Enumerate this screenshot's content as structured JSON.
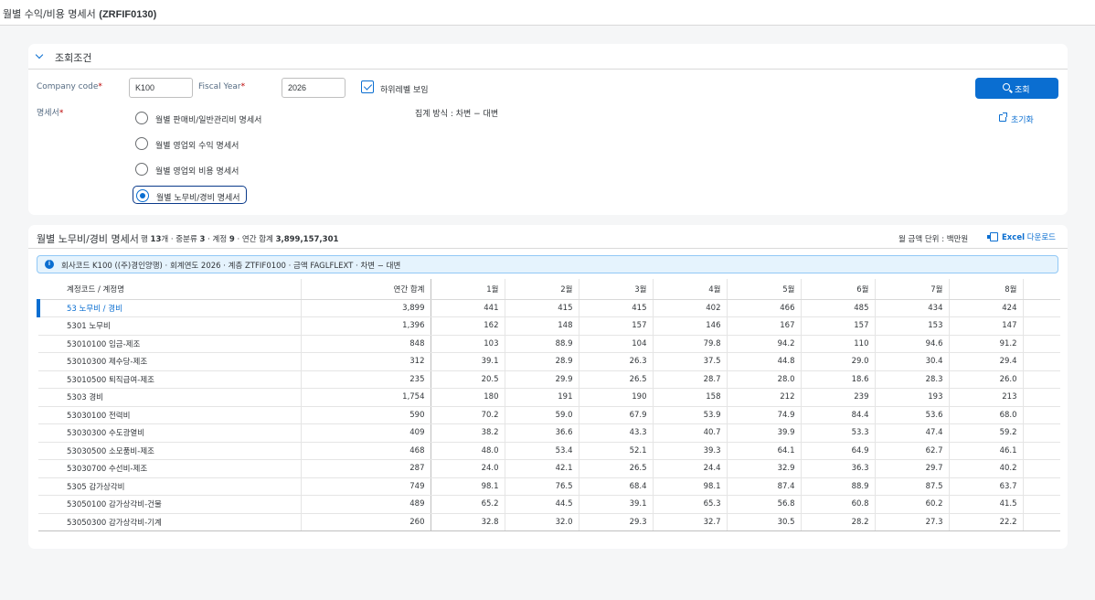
{
  "page": {
    "title": "월별 수익/비용 명세서",
    "code": "(ZRFIF0130)"
  },
  "filter": {
    "header": "조회조건",
    "company_code_label": "Company code",
    "company_code_value": "K100",
    "fiscal_year_label": "Fiscal Year",
    "fiscal_year_value": "2026",
    "required_mark": "*",
    "show_sublevel_label": "하위레벨 보임",
    "statement_label": "명세서",
    "statements": [
      "월별 판매비/일반관리비 명세서",
      "월별 영업외 수익 명세서",
      "월별 영업외 비용 명세서",
      "월별 노무비/경비 명세서"
    ],
    "selected_statement_index": 3,
    "aggregation": "집계 방식 : 차변 − 대변",
    "search_button": "조회",
    "reset_button": "초기화"
  },
  "result": {
    "title": "월별 노무비/경비 명세서",
    "meta": {
      "rows_prefix": "행 ",
      "rows": "13",
      "rows_suffix": "개 · 중분류 ",
      "groups": "3",
      "groups_suffix": " · 계정 ",
      "accounts": "9",
      "accounts_suffix": " · 연간 합계 ",
      "annual_total": "3,899,157,301"
    },
    "unit": "월 금액 단위 : 백만원",
    "excel_bold": "Excel",
    "excel_rest": "다운로드",
    "info": "회사코드 K100 ((주)경인양행) · 회계연도 2026 · 계층 ZTFIF0100 · 금액 FAGLFLEXT · 차변 − 대변",
    "info_icon": "i",
    "columns": {
      "name": "계정코드 / 계정명",
      "total": "연간 합계",
      "months": [
        "1월",
        "2월",
        "3월",
        "4월",
        "5월",
        "6월",
        "7월",
        "8월"
      ]
    },
    "rows": [
      {
        "name": "53 노무비 / 경비",
        "total": "3,899",
        "months": [
          "441",
          "415",
          "415",
          "402",
          "466",
          "485",
          "434",
          "424"
        ]
      },
      {
        "name": "5301 노무비",
        "total": "1,396",
        "months": [
          "162",
          "148",
          "157",
          "146",
          "167",
          "157",
          "153",
          "147"
        ]
      },
      {
        "name": "53010100 임금-제조",
        "total": "848",
        "months": [
          "103",
          "88.9",
          "104",
          "79.8",
          "94.2",
          "110",
          "94.6",
          "91.2"
        ]
      },
      {
        "name": "53010300 제수당-제조",
        "total": "312",
        "months": [
          "39.1",
          "28.9",
          "26.3",
          "37.5",
          "44.8",
          "29.0",
          "30.4",
          "29.4"
        ]
      },
      {
        "name": "53010500 퇴직급여-제조",
        "total": "235",
        "months": [
          "20.5",
          "29.9",
          "26.5",
          "28.7",
          "28.0",
          "18.6",
          "28.3",
          "26.0"
        ]
      },
      {
        "name": "5303 경비",
        "total": "1,754",
        "months": [
          "180",
          "191",
          "190",
          "158",
          "212",
          "239",
          "193",
          "213"
        ]
      },
      {
        "name": "53030100 전력비",
        "total": "590",
        "months": [
          "70.2",
          "59.0",
          "67.9",
          "53.9",
          "74.9",
          "84.4",
          "53.6",
          "68.0"
        ]
      },
      {
        "name": "53030300 수도광열비",
        "total": "409",
        "months": [
          "38.2",
          "36.6",
          "43.3",
          "40.7",
          "39.9",
          "53.3",
          "47.4",
          "59.2"
        ]
      },
      {
        "name": "53030500 소모품비-제조",
        "total": "468",
        "months": [
          "48.0",
          "53.4",
          "52.1",
          "39.3",
          "64.1",
          "64.9",
          "62.7",
          "46.1"
        ]
      },
      {
        "name": "53030700 수선비-제조",
        "total": "287",
        "months": [
          "24.0",
          "42.1",
          "26.5",
          "24.4",
          "32.9",
          "36.3",
          "29.7",
          "40.2"
        ]
      },
      {
        "name": "5305 감가상각비",
        "total": "749",
        "months": [
          "98.1",
          "76.5",
          "68.4",
          "98.1",
          "87.4",
          "88.9",
          "87.5",
          "63.7"
        ]
      },
      {
        "name": "53050100 감가상각비-건물",
        "total": "489",
        "months": [
          "65.2",
          "44.5",
          "39.1",
          "65.3",
          "56.8",
          "60.8",
          "60.2",
          "41.5"
        ]
      },
      {
        "name": "53050300 감가상각비-기계",
        "total": "260",
        "months": [
          "32.8",
          "32.0",
          "29.3",
          "32.7",
          "30.5",
          "28.2",
          "27.3",
          "22.2"
        ]
      }
    ]
  },
  "icons": {
    "collapse": "chevron-down-icon",
    "search": "search-icon",
    "reset": "reset-icon",
    "excel": "excel-icon",
    "info": "info-icon"
  },
  "colors": {
    "accent": "#0a6ed1",
    "required": "#bb0000",
    "info_bg": "#e5f3fd"
  }
}
